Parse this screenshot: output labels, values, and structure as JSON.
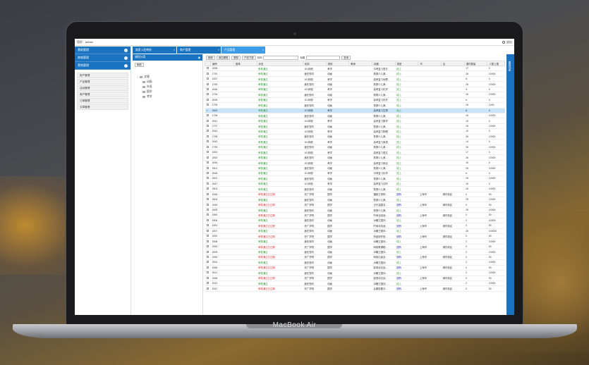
{
  "device": {
    "brand": "MacBook Air"
  },
  "topbar": {
    "user": "您好：admin",
    "exit": "退出"
  },
  "sidebar": {
    "sections": [
      {
        "label": "基础管理"
      },
      {
        "label": "商城管理"
      },
      {
        "label": "营销管理"
      }
    ],
    "items": [
      {
        "label": "用户管理"
      },
      {
        "label": "产品管理"
      },
      {
        "label": "活动管理"
      },
      {
        "label": "商户管理"
      },
      {
        "label": "订单管理"
      },
      {
        "label": "文章管理"
      }
    ]
  },
  "tabs": [
    {
      "label": "商家入驻审核"
    },
    {
      "label": "商户管理"
    },
    {
      "label": "产品管理"
    }
  ],
  "category": {
    "title": "课程分类",
    "refresh": "刷新",
    "root": "文理",
    "children": [
      "动画",
      "外语",
      "国学",
      "考学"
    ]
  },
  "toolbar": {
    "b1": "刷新",
    "b2": "添加课程",
    "b3": "删除",
    "b4": "产品下架",
    "l1": "机构",
    "l2": "标题",
    "search": "查询"
  },
  "table": {
    "headers": [
      "",
      "编号",
      "推荐",
      "状态",
      "机构",
      "类别",
      "教师",
      "标题",
      "类型",
      "市",
      "区",
      "课件数量",
      "人数上限"
    ],
    "rows": [
      [
        "1838",
        "",
        "审核通过",
        "101网校",
        "考学",
        "",
        "中考复习语文",
        "线上",
        "",
        "",
        "17",
        "0"
      ],
      [
        "1792",
        "",
        "审核通过",
        "鑫在视坊",
        "动画",
        "",
        "勤携少儿美...",
        "线上",
        "",
        "",
        "26",
        "10000"
      ],
      [
        "1837",
        "",
        "审核通过",
        "101网校",
        "考学",
        "",
        "高考复习地理",
        "线上",
        "",
        "",
        "8",
        "0"
      ],
      [
        "1789",
        "",
        "审核通过",
        "鑫在视坊",
        "动画",
        "",
        "勤携少儿美...",
        "线上",
        "",
        "",
        "26",
        "10000"
      ],
      [
        "1836",
        "",
        "审核通过",
        "101网校",
        "考学",
        "",
        "高考复习化学",
        "线上",
        "",
        "",
        "9",
        "0"
      ],
      [
        "1794",
        "",
        "审核通过",
        "鑫在视坊",
        "动画",
        "",
        "勤携少儿美...",
        "线上",
        "",
        "",
        "26",
        "10000"
      ],
      [
        "1835",
        "",
        "审核通过",
        "101网校",
        "考学",
        "",
        "高考复习历史",
        "线上",
        "",
        "",
        "6",
        "0"
      ],
      [
        "1795",
        "",
        "审核通过",
        "鑫在视坊",
        "动画",
        "",
        "勤携少儿美...",
        "线上",
        "",
        "",
        "26",
        "1000"
      ],
      [
        "1840",
        "",
        "审核通过",
        "101网校",
        "考学",
        "",
        "高考复习生物",
        "线上",
        "",
        "",
        "8",
        "0"
      ],
      [
        "1796",
        "",
        "审核通过",
        "鑫在视坊",
        "动画",
        "",
        "勤携少儿美...",
        "线上",
        "",
        "",
        "26",
        "10000"
      ],
      [
        "1841",
        "",
        "审核通过",
        "101网校",
        "考学",
        "",
        "高考复习数学",
        "线上",
        "",
        "",
        "13",
        "0"
      ],
      [
        "1797",
        "",
        "审核通过",
        "鑫在视坊",
        "动画",
        "",
        "勤携少儿美...",
        "线上",
        "",
        "",
        "26",
        "10000"
      ],
      [
        "1842",
        "",
        "审核通过",
        "101网校",
        "考学",
        "",
        "高考复习物理",
        "线上",
        "",
        "",
        "10",
        "0"
      ],
      [
        "1798",
        "",
        "审核通过",
        "鑫在视坊",
        "动画",
        "",
        "勤携少儿美...",
        "线上",
        "",
        "",
        "26",
        "10000"
      ],
      [
        "1843",
        "",
        "审核通过",
        "101网校",
        "考学",
        "",
        "高考复习英语",
        "线上",
        "",
        "",
        "14",
        "0"
      ],
      [
        "1799",
        "",
        "审核通过",
        "鑫在视坊",
        "动画",
        "",
        "勤携少儿美...",
        "线上",
        "",
        "",
        "26",
        "10000"
      ],
      [
        "1844",
        "",
        "审核通过",
        "101网校",
        "考学",
        "",
        "高考复习语文",
        "线上",
        "",
        "",
        "17",
        "0"
      ],
      [
        "1800",
        "",
        "审核通过",
        "鑫在视坊",
        "动画",
        "",
        "勤携少儿美...",
        "线上",
        "",
        "",
        "26",
        "10000"
      ],
      [
        "1845",
        "",
        "审核通过",
        "101网校",
        "考学",
        "",
        "高考复习政治",
        "线上",
        "",
        "",
        "10",
        "0"
      ],
      [
        "1801",
        "",
        "审核通过",
        "鑫在视坊",
        "动画",
        "",
        "勤携少儿美...",
        "线上",
        "",
        "",
        "26",
        "10000"
      ],
      [
        "1846",
        "",
        "审核通过",
        "101网校",
        "考学",
        "",
        "中考复习化学",
        "线上",
        "",
        "",
        "6",
        "0"
      ],
      [
        "1802",
        "",
        "审核通过",
        "鑫在视坊",
        "动画",
        "",
        "勤携少儿美...",
        "线上",
        "",
        "",
        "26",
        "10000"
      ],
      [
        "1847",
        "",
        "审核通过",
        "101网校",
        "考学",
        "",
        "高考复习试听",
        "线上",
        "",
        "",
        "10",
        "0"
      ],
      [
        "1803",
        "",
        "审核通过",
        "鑫在视坊",
        "动画",
        "",
        "勤携少儿美...",
        "线上",
        "",
        "",
        "26",
        "10000"
      ],
      [
        "1548",
        "",
        "审核通过已过期",
        "央广学院",
        "国学",
        "",
        "疆医王师院...",
        "团购",
        "上海市",
        "浦东新区",
        "0",
        "50"
      ],
      [
        "1804",
        "",
        "审核通过",
        "鑫在视坊",
        "动画",
        "",
        "勤携少儿美...",
        "线上",
        "",
        "",
        "25",
        "10000"
      ],
      [
        "1549",
        "",
        "审核通过已过期",
        "央广学院",
        "国学",
        "",
        "古代温整名...",
        "团购",
        "上海市",
        "浦东新区",
        "0",
        "50"
      ],
      [
        "1805",
        "",
        "审核通过",
        "鑫在视坊",
        "动画",
        "",
        "勤携少儿美...",
        "线上",
        "",
        "",
        "25",
        "10000"
      ],
      [
        "1550",
        "",
        "审核通过已过期",
        "央广学院",
        "国学",
        "",
        "时间化攻适...",
        "团购",
        "上海市",
        "浦东新区",
        "0",
        "50"
      ],
      [
        "1806",
        "",
        "审核通过",
        "鑫在视坊",
        "动画",
        "",
        "冰暖王国问...",
        "线上",
        "",
        "",
        "2",
        "10000"
      ],
      [
        "1551",
        "",
        "审核通过已过期",
        "央广学院",
        "国学",
        "",
        "时间化攻适...",
        "团购",
        "上海市",
        "浦东新区",
        "0",
        "50"
      ],
      [
        "1807",
        "",
        "审核通过",
        "鑫在视坊",
        "动画",
        "",
        "冰暖王国问...",
        "线上",
        "",
        "",
        "26",
        "100000"
      ],
      [
        "1552",
        "",
        "审核通过已过期",
        "央广学院",
        "国学",
        "",
        "热品制作班...",
        "团购",
        "上海市",
        "浦东新区",
        "0",
        "50"
      ],
      [
        "1808",
        "",
        "审核通过",
        "鑫在视坊",
        "动画",
        "",
        "冰暖王国问...",
        "线上",
        "",
        "",
        "2",
        "10000"
      ],
      [
        "1553",
        "",
        "审核通过已过期",
        "央广学院",
        "国学",
        "",
        "网络教课程...",
        "团购",
        "上海市",
        "浦东新区",
        "0",
        "50"
      ],
      [
        "1809",
        "",
        "审核通过",
        "鑫在视坊",
        "动画",
        "",
        "冰暖王国问...",
        "线上",
        "",
        "",
        "2",
        "10000"
      ],
      [
        "1554",
        "",
        "审核通过已过期",
        "央广学院",
        "国学",
        "",
        "网络出量全...",
        "团购",
        "上海市",
        "浦东新区",
        "0",
        "50"
      ],
      [
        "1810",
        "",
        "审核通过",
        "鑫在视坊",
        "动画",
        "",
        "冰暖王国问...",
        "线上",
        "",
        "",
        "2",
        "10000"
      ],
      [
        "1555",
        "",
        "审核通过已过期",
        "央广学院",
        "国学",
        "",
        "影视化论品...",
        "团购",
        "上海市",
        "浦东新区",
        "0",
        "50"
      ],
      [
        "1811",
        "",
        "审核通过",
        "鑫在视坊",
        "动画",
        "",
        "冰暖王国问...",
        "线上",
        "",
        "",
        "2",
        "10000"
      ],
      [
        "1556",
        "",
        "审核通过已过期",
        "央广学院",
        "国学",
        "",
        "影视化论品...",
        "团购",
        "上海市",
        "浦东新区",
        "0",
        "50"
      ],
      [
        "1812",
        "",
        "审核通过",
        "鑫在视坊",
        "动画",
        "",
        "冰暖王国问...",
        "线上",
        "",
        "",
        "2",
        "10000"
      ],
      [
        "1557",
        "",
        "审核通过已过期",
        "央广学院",
        "国学",
        "",
        "后期剪要分...",
        "团购",
        "上海市",
        "浦东新区",
        "0",
        "50"
      ]
    ]
  },
  "rightbar": {
    "label": "图层列表"
  }
}
